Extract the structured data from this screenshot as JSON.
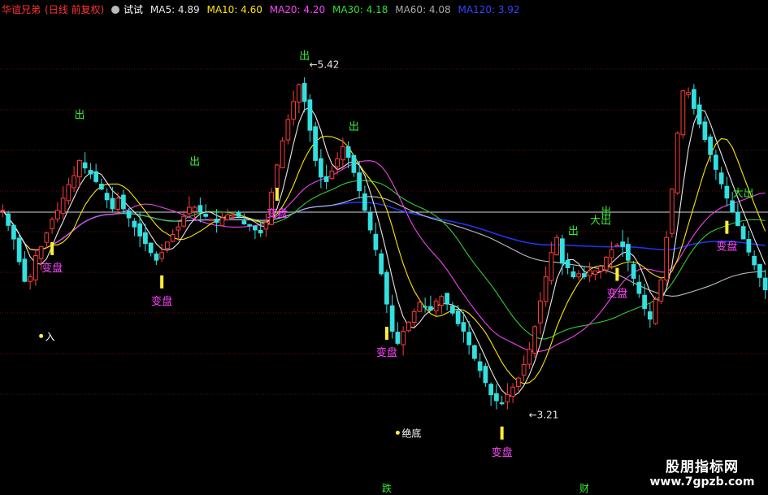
{
  "header": {
    "stock_name": "华谊兄弟",
    "period": "(日线 前复权)",
    "indicator": "试试",
    "ma_labels": [
      {
        "text": "MA5: 4.89",
        "color": "#e8e8e8"
      },
      {
        "text": "MA10: 4.60",
        "color": "#ffe600"
      },
      {
        "text": "MA20: 4.20",
        "color": "#ff44ff"
      },
      {
        "text": "MA30: 4.18",
        "color": "#33dd33"
      },
      {
        "text": "MA60: 4.08",
        "color": "#aaaaaa"
      },
      {
        "text": "MA120: 3.92",
        "color": "#3344ff"
      }
    ]
  },
  "watermark": {
    "title": "股朋指标网",
    "url": "www.7gpzb.com"
  },
  "chart_data": {
    "type": "candlestick",
    "ylim": [
      2.9,
      5.75
    ],
    "n_bars": 126,
    "close": [
      4.52,
      4.42,
      4.33,
      4.18,
      4.05,
      4.08,
      4.22,
      4.28,
      4.37,
      4.46,
      4.52,
      4.6,
      4.69,
      4.75,
      4.85,
      4.8,
      4.76,
      4.71,
      4.66,
      4.59,
      4.53,
      4.6,
      4.53,
      4.47,
      4.41,
      4.35,
      4.3,
      4.24,
      4.19,
      4.24,
      4.31,
      4.36,
      4.41,
      4.48,
      4.54,
      4.54,
      4.51,
      4.48,
      4.46,
      4.44,
      4.47,
      4.49,
      4.49,
      4.48,
      4.43,
      4.42,
      4.39,
      4.37,
      4.44,
      4.64,
      4.82,
      4.98,
      5.12,
      5.24,
      5.35,
      5.24,
      5.05,
      4.85,
      4.74,
      4.71,
      4.78,
      4.86,
      4.94,
      4.87,
      4.77,
      4.65,
      4.52,
      4.39,
      4.26,
      4.1,
      3.9,
      3.72,
      3.64,
      3.72,
      3.78,
      3.85,
      3.91,
      3.88,
      3.86,
      3.92,
      3.95,
      3.9,
      3.84,
      3.77,
      3.72,
      3.63,
      3.54,
      3.46,
      3.38,
      3.3,
      3.26,
      3.24,
      3.3,
      3.35,
      3.41,
      3.5,
      3.6,
      3.75,
      3.92,
      4.08,
      4.24,
      4.34,
      4.17,
      4.14,
      4.08,
      4.1,
      4.08,
      4.12,
      4.12,
      4.15,
      4.21,
      4.26,
      4.29,
      4.28,
      4.19,
      4.07,
      3.97,
      3.87,
      3.8,
      3.93,
      4.06,
      4.34,
      4.66,
      5.03,
      5.31,
      5.3
    ],
    "markers": [
      {
        "bar": 14,
        "label": "出",
        "type": "sell"
      },
      {
        "bar": 35,
        "label": "出",
        "type": "sell"
      },
      {
        "bar": 55,
        "label": "出",
        "type": "sell"
      },
      {
        "bar": 64,
        "label": "出",
        "type": "sell"
      },
      {
        "bar": 104,
        "label": "出",
        "type": "sell"
      },
      {
        "bar": 110,
        "label": "出",
        "type": "sell"
      },
      {
        "bar": 109,
        "label": "大出",
        "type": "sell"
      },
      {
        "bar": 135,
        "label": "大出",
        "type": "sell"
      },
      {
        "bar": 9,
        "label": "变盘",
        "type": "pivot"
      },
      {
        "bar": 29,
        "label": "变盘",
        "type": "pivot"
      },
      {
        "bar": 50,
        "label": "变盘",
        "type": "pivot"
      },
      {
        "bar": 70,
        "label": "变盘",
        "type": "pivot"
      },
      {
        "bar": 91,
        "label": "变盘",
        "type": "pivot"
      },
      {
        "bar": 112,
        "label": "变盘",
        "type": "pivot"
      },
      {
        "bar": 132,
        "label": "变盘",
        "type": "pivot"
      },
      {
        "bar": 7,
        "label": "入",
        "type": "dot"
      },
      {
        "bar": 72,
        "label": "绝底",
        "type": "dot"
      }
    ],
    "extremes": [
      {
        "label": "5.42",
        "kind": "high",
        "bar": 55
      },
      {
        "label": "3.21",
        "kind": "low",
        "bar": 95
      }
    ],
    "bottom_labels": [
      {
        "text": "跌",
        "bar": 70
      },
      {
        "text": "财",
        "bar": 106
      }
    ]
  }
}
